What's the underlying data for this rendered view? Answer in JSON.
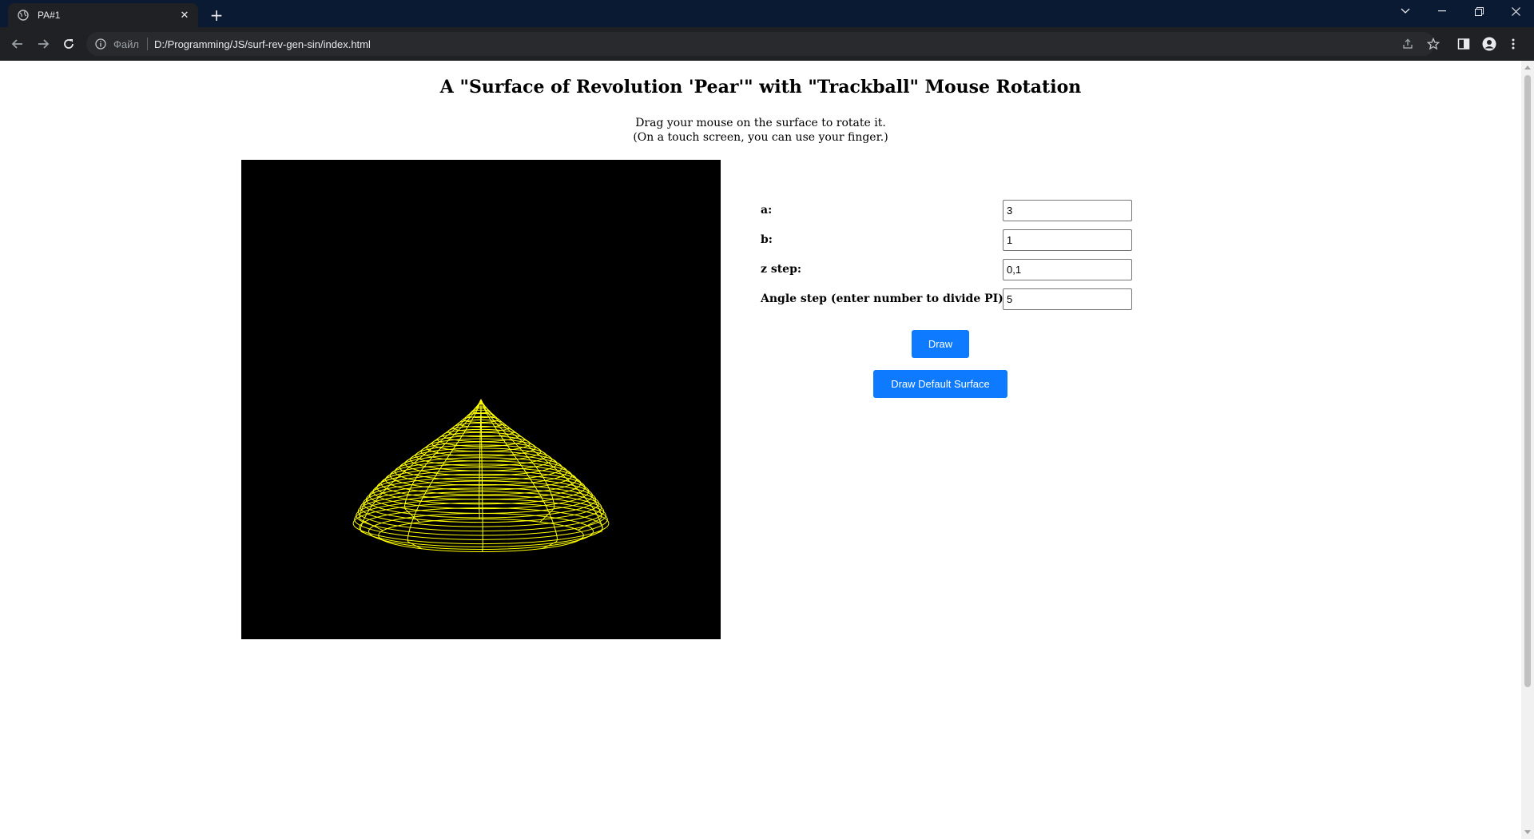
{
  "browser": {
    "tab_title": "PA#1",
    "tab_close_glyph": "✕",
    "new_tab_glyph": "+",
    "address_scheme_label": "Файл",
    "address_url": "D:/Programming/JS/surf-rev-gen-sin/index.html",
    "icons": [
      "globe-icon",
      "close-icon",
      "plus-icon",
      "chevron-down-icon",
      "minimize-icon",
      "restore-icon",
      "close-window-icon",
      "back-arrow-icon",
      "forward-arrow-icon",
      "reload-icon",
      "info-icon",
      "share-icon",
      "star-icon",
      "sidepanel-icon",
      "profile-icon",
      "menu-dots-icon"
    ]
  },
  "page": {
    "title": "A \"Surface of Revolution 'Pear'\" with \"Trackball\" Mouse Rotation",
    "instructions_line1": "Drag your mouse on the surface to rotate it.",
    "instructions_line2": "(On a touch screen, you can use your finger.)",
    "canvas": {
      "background": "#000000",
      "wire_color": "#ffff00"
    }
  },
  "controls": {
    "fields": [
      {
        "label": "a:",
        "value": "3"
      },
      {
        "label": "b:",
        "value": "1"
      },
      {
        "label": "z step:",
        "value": "0,1"
      },
      {
        "label": "Angle step (enter number to divide PI):",
        "value": "5"
      }
    ],
    "draw_button": "Draw",
    "default_button": "Draw Default Surface",
    "button_color": "#0d7aff"
  }
}
